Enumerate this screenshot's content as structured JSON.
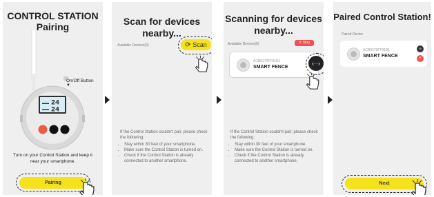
{
  "panels": [
    {
      "title_line1": "CONTROL STATION",
      "title_line2": "Pairing",
      "device_label": "On/Off Button",
      "instruction": "Turn on your Control Station and keep it near your smartphone.",
      "button": "Pairing"
    },
    {
      "title_line1": "Scan for devices",
      "title_line2": "nearby...",
      "available": "Available Devices(0)",
      "scan_button": "Scan",
      "help_intro": "If the Control Station couldn't pair, please check the following:",
      "help_items": [
        "Stay within 30 feet of your smartphone.",
        "Make sure the Control Station is turned on.",
        "Check if the Control Station is already connected to another smartphone."
      ]
    },
    {
      "title_line1": "Scanning for devices",
      "title_line2": "nearby...",
      "available": "Available Devices(0)",
      "stop_button": "Stop",
      "device_id": "ACB0370FF91B1",
      "device_name": "SMART FENCE",
      "help_intro": "If the Control Station couldn't pair, please check the following:",
      "help_items": [
        "Stay within 30 feet of your smartphone.",
        "Make sure the Control Station is turned on.",
        "Check if the Control Station is already connected to another smartphone."
      ]
    },
    {
      "title": "Paired Control Station!",
      "paired_label": "Paired Device",
      "device_id": "ACB0370FF91B1",
      "device_name": "SMART FENCE",
      "button": "Next"
    }
  ],
  "lcd": {
    "row1": "24",
    "row2": "24"
  },
  "icons": {
    "scan_icon": "refresh-icon",
    "link_icon": "link-icon",
    "delete_icon": "close-icon",
    "hand": "pointer-hand-icon"
  },
  "colors": {
    "accent_yellow": "#f6e21a",
    "danger_red": "#f05252",
    "panel_bg": "#efefef"
  }
}
